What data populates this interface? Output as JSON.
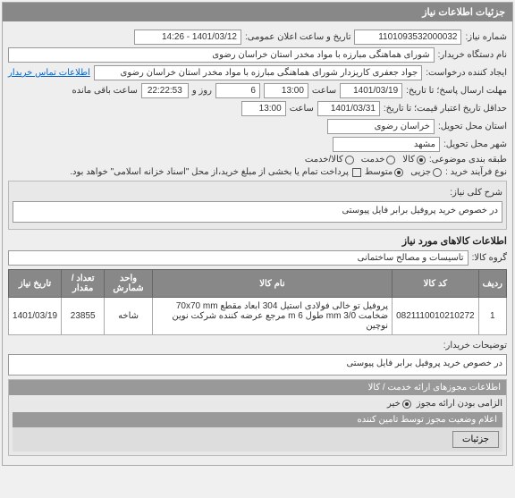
{
  "header": {
    "title": "جزئیات اطلاعات نیاز"
  },
  "fields": {
    "need_number_label": "شماره نیاز:",
    "need_number": "1101093532000032",
    "announce_label": "تاریخ و ساعت اعلان عمومی:",
    "announce_value": "1401/03/12 - 14:26",
    "buyer_org_label": "نام دستگاه خریدار:",
    "buyer_org": "شورای هماهنگی مبارزه با مواد مخدر استان خراسان رضوی",
    "requester_label": "ایجاد کننده درخواست:",
    "requester": "جواد جعفری کاریزدار شورای هماهنگی مبارزه با مواد مخدر استان خراسان رضوی",
    "contact_link": "اطلاعات تماس خریدار",
    "send_deadline_label": "مهلت ارسال پاسخ؛ تا تاریخ:",
    "send_date": "1401/03/19",
    "time_label": "ساعت",
    "send_time": "13:00",
    "remaining_days": "6",
    "days_label": "روز و",
    "remaining_time": "22:22:53",
    "remaining_label": "ساعت باقی مانده",
    "validity_label": "حداقل تاریخ اعتبار قیمت؛ تا تاریخ:",
    "validity_date": "1401/03/31",
    "validity_time": "13:00",
    "province_label": "استان محل تحویل:",
    "province": "خراسان رضوی",
    "city_label": "شهر محل تحویل:",
    "city": "مشهد",
    "category_label": "طبقه بندی موضوعی:",
    "cat_goods": "کالا",
    "cat_service": "خدمت",
    "cat_goods_service": "کالا/خدمت",
    "process_label": "نوع فرآیند خرید :",
    "proc_low": "جزیی",
    "proc_mid": "متوسط",
    "payment_note": "پرداخت تمام یا بخشی از مبلغ خرید،از محل \"اسناد خزانه اسلامی\" خواهد بود.",
    "checkbox_label": ""
  },
  "desc": {
    "general_label": "شرح کلی نیاز:",
    "general_text": "در خصوص خرید پروفیل برابر فایل پیوستی"
  },
  "goods": {
    "section_title": "اطلاعات کالاهای مورد نیاز",
    "group_label": "گروه کالا:",
    "group_value": "تاسیسات و مصالح ساختمانی"
  },
  "table": {
    "headers": {
      "row": "ردیف",
      "code": "کد کالا",
      "name": "نام کالا",
      "unit": "واحد شمارش",
      "qty": "تعداد / مقدار",
      "date": "تاریخ نیاز"
    },
    "rows": [
      {
        "row": "1",
        "code": "0821110010210272",
        "name": "پروفیل تو خالی فولادی استیل 304 ابعاد مقطع 70x70 mm ضخامت 3/0 mm طول 6 m مرجع عرضه کننده شرکت نوین نوچین",
        "unit": "شاخه",
        "qty": "23855",
        "date": "1401/03/19"
      }
    ]
  },
  "buyer_desc": {
    "label": "توضیحات خریدار:",
    "text": "در خصوص خرید پروفیل برابر فایل پیوستی"
  },
  "footer": {
    "licenses_title": "اطلاعات مجوزهای ارائه خدمت / کالا",
    "mandatory_label": "الزامی بودن ارائه مجوز",
    "no": "خیر",
    "status_title": "اعلام وضعیت مجوز توسط تامین کننده",
    "details_btn": "جزئیات"
  }
}
